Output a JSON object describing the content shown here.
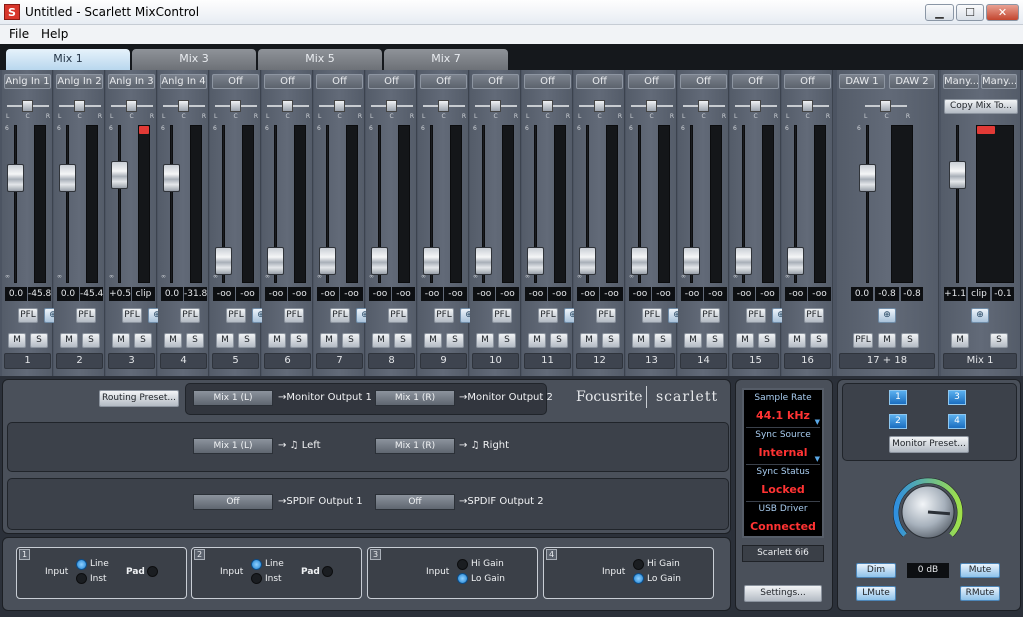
{
  "window": {
    "title": "Untitled - Scarlett MixControl",
    "app_icon": "S",
    "minimize": "▁",
    "maximize": "☐",
    "close": "✕"
  },
  "menu": [
    "File",
    "Help"
  ],
  "tabs": [
    "Mix 1",
    "Mix 3",
    "Mix 5",
    "Mix 7"
  ],
  "active_tab": "Mix 1",
  "pan_labels": {
    "l": "L",
    "c": "C",
    "r": "R"
  },
  "fader_scale": {
    "top": "6",
    "zero": "0",
    "bottom": "∞"
  },
  "strips": [
    {
      "label": "Anlg In 1",
      "fader_db": "0.0",
      "level": "-45.8",
      "number": "1",
      "fader_pos": 0.7,
      "clip": false
    },
    {
      "label": "Anlg In 2",
      "fader_db": "0.0",
      "level": "-45.4",
      "number": "2",
      "fader_pos": 0.7,
      "clip": false
    },
    {
      "label": "Anlg In 3",
      "fader_db": "+0.5",
      "level": "clip",
      "number": "3",
      "fader_pos": 0.72,
      "clip": true
    },
    {
      "label": "Anlg In 4",
      "fader_db": "0.0",
      "level": "-31.8",
      "number": "4",
      "fader_pos": 0.7,
      "clip": false
    },
    {
      "label": "Off",
      "fader_db": "-oo",
      "level": "-oo",
      "number": "5",
      "fader_pos": 0.06,
      "clip": false
    },
    {
      "label": "Off",
      "fader_db": "-oo",
      "level": "-oo",
      "number": "6",
      "fader_pos": 0.06,
      "clip": false
    },
    {
      "label": "Off",
      "fader_db": "-oo",
      "level": "-oo",
      "number": "7",
      "fader_pos": 0.06,
      "clip": false
    },
    {
      "label": "Off",
      "fader_db": "-oo",
      "level": "-oo",
      "number": "8",
      "fader_pos": 0.06,
      "clip": false
    },
    {
      "label": "Off",
      "fader_db": "-oo",
      "level": "-oo",
      "number": "9",
      "fader_pos": 0.06,
      "clip": false
    },
    {
      "label": "Off",
      "fader_db": "-oo",
      "level": "-oo",
      "number": "10",
      "fader_pos": 0.06,
      "clip": false
    },
    {
      "label": "Off",
      "fader_db": "-oo",
      "level": "-oo",
      "number": "11",
      "fader_pos": 0.06,
      "clip": false
    },
    {
      "label": "Off",
      "fader_db": "-oo",
      "level": "-oo",
      "number": "12",
      "fader_pos": 0.06,
      "clip": false
    },
    {
      "label": "Off",
      "fader_db": "-oo",
      "level": "-oo",
      "number": "13",
      "fader_pos": 0.06,
      "clip": false
    },
    {
      "label": "Off",
      "fader_db": "-oo",
      "level": "-oo",
      "number": "14",
      "fader_pos": 0.06,
      "clip": false
    },
    {
      "label": "Off",
      "fader_db": "-oo",
      "level": "-oo",
      "number": "15",
      "fader_pos": 0.06,
      "clip": false
    },
    {
      "label": "Off",
      "fader_db": "-oo",
      "level": "-oo",
      "number": "16",
      "fader_pos": 0.06,
      "clip": false
    }
  ],
  "pair_buttons": {
    "pfl": "PFL",
    "mute": "M",
    "solo": "S",
    "link_icon": "link-icon"
  },
  "daw_strip": {
    "label_l": "DAW 1",
    "label_r": "DAW 2",
    "fader_db": "0.0",
    "level_l": "-0.8",
    "level_r": "-0.8",
    "number": "17 + 18",
    "fader_pos": 0.7
  },
  "master_strip": {
    "label_l": "Many...",
    "label_r": "Many...",
    "copy_mix": "Copy Mix To...",
    "fader_db": "+1.1",
    "level_l": "clip",
    "level_r": "-0.1",
    "number": "Mix 1",
    "fader_pos": 0.72,
    "clip": true
  },
  "routing": {
    "preset_button": "Routing Preset...",
    "monitor_l_src": "Mix 1 (L)",
    "monitor_l_dest": "Monitor Output 1",
    "monitor_r_src": "Mix 1 (R)",
    "monitor_r_dest": "Monitor Output 2",
    "hp_l_src": "Mix 1 (L)",
    "hp_l_dest": "Left",
    "hp_r_src": "Mix 1 (R)",
    "hp_r_dest": "Right",
    "spdif1_src": "Off",
    "spdif1_dest": "SPDIF Output 1",
    "spdif2_src": "Off",
    "spdif2_dest": "SPDIF Output 2",
    "arrow": "→",
    "headphone_icon": "headphone-icon"
  },
  "brand": {
    "focusrite": "Focusrite",
    "scarlett": "scarlett"
  },
  "status": {
    "sample_rate_label": "Sample Rate",
    "sample_rate": "44.1 kHz",
    "sync_source_label": "Sync Source",
    "sync_source": "Internal",
    "sync_status_label": "Sync Status",
    "sync_status": "Locked",
    "usb_label": "USB  Driver",
    "usb_status": "Connected",
    "device": "Scarlett 6i6",
    "settings_button": "Settings..."
  },
  "monitor": {
    "ch1": "1",
    "ch2": "2",
    "ch3": "3",
    "ch4": "4",
    "preset_button": "Monitor Preset...",
    "volume": "0 dB",
    "dim": "Dim",
    "mute": "Mute",
    "lmute": "LMute",
    "rmute": "RMute",
    "knob_level": 0.85
  },
  "inputs": [
    {
      "num": "1",
      "input": "Input",
      "opt_a": "Line",
      "opt_b": "Inst",
      "pad": "Pad",
      "selected": "Line"
    },
    {
      "num": "2",
      "input": "Input",
      "opt_a": "Line",
      "opt_b": "Inst",
      "pad": "Pad",
      "selected": "Line"
    },
    {
      "num": "3",
      "input": "Input",
      "opt_a": "Hi Gain",
      "opt_b": "Lo Gain",
      "selected": "Lo Gain"
    },
    {
      "num": "4",
      "input": "Input",
      "opt_a": "Hi Gain",
      "opt_b": "Lo Gain",
      "selected": "Lo Gain"
    }
  ],
  "colors": {
    "accent": "#7fb6e6",
    "status_red": "#ff3333",
    "status_label": "#a9cdf0",
    "clip": "#e23a36"
  }
}
